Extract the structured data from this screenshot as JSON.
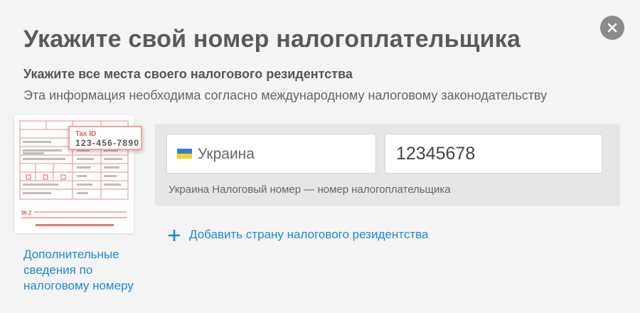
{
  "header": {
    "title": "Укажите свой номер налогоплательщика",
    "subtitle": "Укажите все места своего налогового резидентства",
    "description": "Эта информация необходима согласно международному налоговому законодательству"
  },
  "close_icon": "close-icon",
  "form_illustration": {
    "tax_id_label": "Tax ID",
    "tax_id_value": "123-456-7890"
  },
  "tax_info_link": "Дополнительные сведения по налоговому номеру",
  "residency": {
    "country": "Украина",
    "country_flag_icon": "flag-ukraine-icon",
    "tax_number": "12345678",
    "hint": "Украина Налоговый номер — номер налогоплательщика"
  },
  "add_country": {
    "label": "Добавить страну налогового резидентства",
    "icon": "plus-icon"
  },
  "colors": {
    "accent_link": "#1a8ad6",
    "background": "#f4f4f4",
    "panel": "#e6e6e6",
    "close_button": "#8a8a8a",
    "form_red": "#e06060"
  }
}
